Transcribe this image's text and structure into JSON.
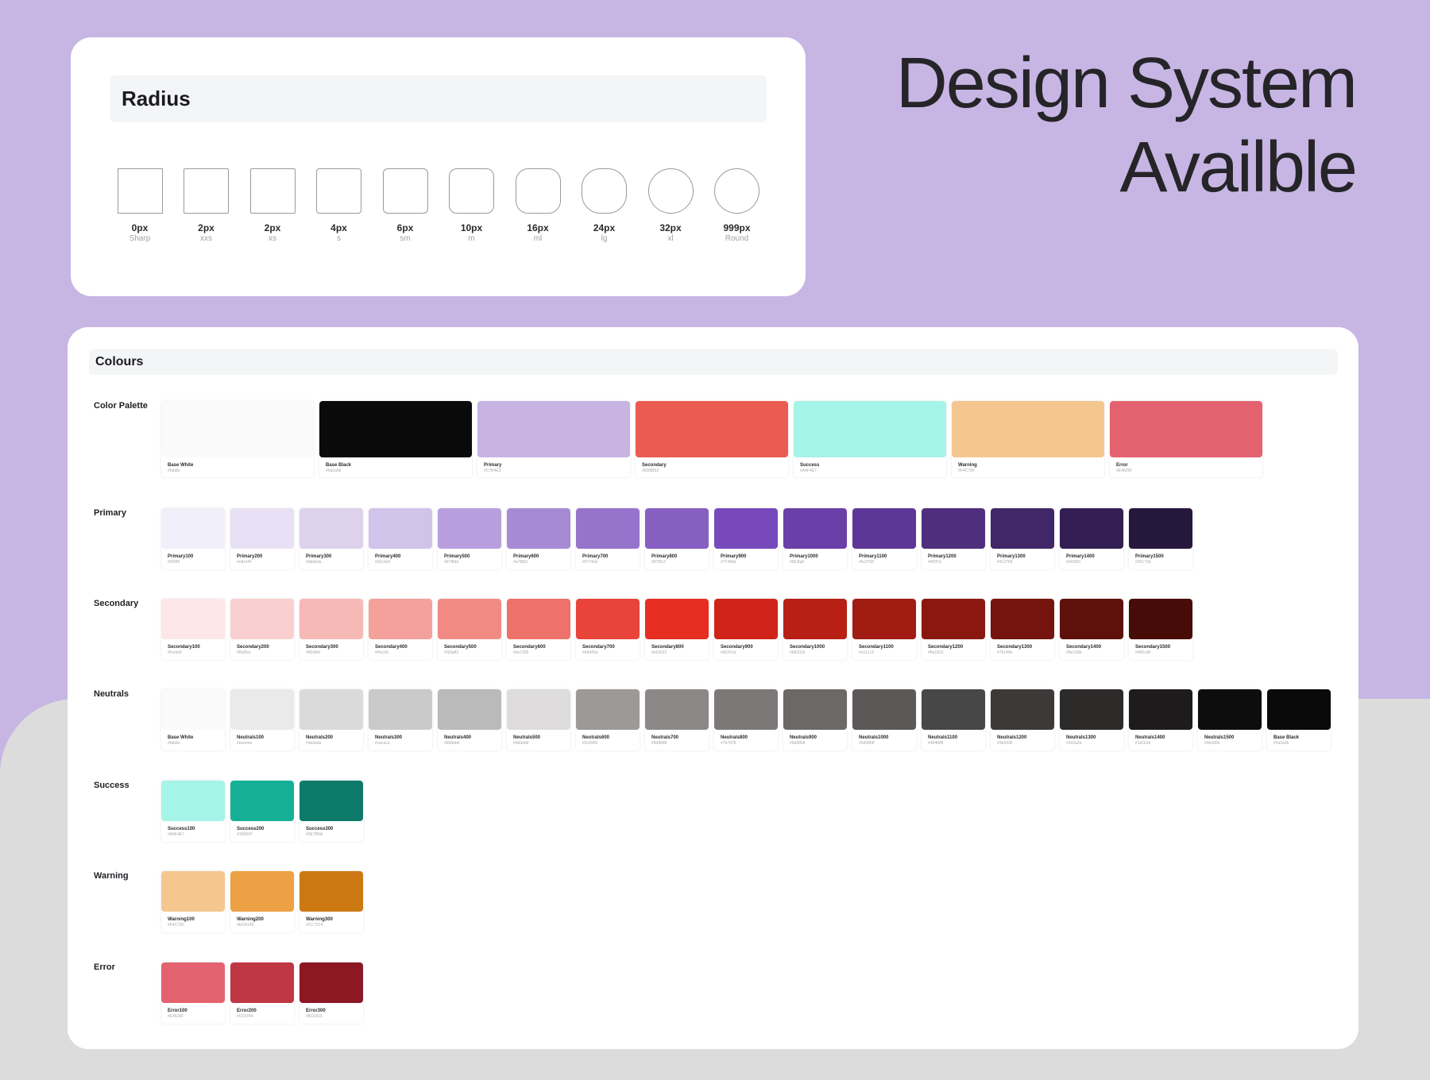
{
  "headline": {
    "line1": "Design System",
    "line2": "Availble"
  },
  "radius": {
    "title": "Radius",
    "items": [
      {
        "value": "0px",
        "name": "Sharp",
        "radius": 0
      },
      {
        "value": "2px",
        "name": "xxs",
        "radius": 2
      },
      {
        "value": "2px",
        "name": "xs",
        "radius": 2
      },
      {
        "value": "4px",
        "name": "s",
        "radius": 4
      },
      {
        "value": "6px",
        "name": "sm",
        "radius": 6
      },
      {
        "value": "10px",
        "name": "m",
        "radius": 10
      },
      {
        "value": "16px",
        "name": "ml",
        "radius": 16
      },
      {
        "value": "24px",
        "name": "lg",
        "radius": 24
      },
      {
        "value": "32px",
        "name": "xl",
        "radius": 32
      },
      {
        "value": "999px",
        "name": "Round",
        "radius": 999
      }
    ]
  },
  "colours": {
    "title": "Colours",
    "palette": {
      "label": "Color Palette",
      "swatches": [
        {
          "name": "Base White",
          "hex": "#fafafa",
          "color": "#fafafa"
        },
        {
          "name": "Base Black",
          "hex": "#0a0a0b",
          "color": "#0a0a0b"
        },
        {
          "name": "Primary",
          "hex": "#C7B4E3",
          "color": "#C7B4E3"
        },
        {
          "name": "Secondary",
          "hex": "#EB5B52",
          "color": "#EB5B52"
        },
        {
          "name": "Success",
          "hex": "#A4F4E7",
          "color": "#A4F4E7"
        },
        {
          "name": "Warning",
          "hex": "#F4C790",
          "color": "#F4C790"
        },
        {
          "name": "Error",
          "hex": "#E4626F",
          "color": "#E4626F"
        }
      ]
    },
    "rows": [
      {
        "id": "primary",
        "label": "Primary",
        "swatches": [
          {
            "name": "Primary100",
            "hex": "#f1f0f9",
            "color": "#f1effa"
          },
          {
            "name": "Primary200",
            "hex": "#e9e1f4",
            "color": "#e8e0f4"
          },
          {
            "name": "Primary300",
            "hex": "#ddd2eb",
            "color": "#ddd1ec"
          },
          {
            "name": "Primary400",
            "hex": "#d2c3e9",
            "color": "#d1c3e9"
          },
          {
            "name": "Primary500",
            "hex": "#b79fdd",
            "color": "#b79fdd"
          },
          {
            "name": "Primary600",
            "hex": "#a78fd3",
            "color": "#a68bd4"
          },
          {
            "name": "Primary700",
            "hex": "#9774cb",
            "color": "#9774cb"
          },
          {
            "name": "Primary800",
            "hex": "#875fc3",
            "color": "#875fc3"
          },
          {
            "name": "Primary900",
            "hex": "#7749bb",
            "color": "#7749bb"
          },
          {
            "name": "Primary1000",
            "hex": "#6b3fa8",
            "color": "#6b3fa8"
          },
          {
            "name": "Primary1100",
            "hex": "#5c3793",
            "color": "#5e3796"
          },
          {
            "name": "Primary1200",
            "hex": "#4f2f7d",
            "color": "#4f2f7d"
          },
          {
            "name": "Primary1300",
            "hex": "#412768",
            "color": "#412768"
          },
          {
            "name": "Primary1400",
            "hex": "#341f53",
            "color": "#331f53"
          },
          {
            "name": "Primary1500",
            "hex": "#26173d",
            "color": "#26173d"
          }
        ]
      },
      {
        "id": "secondary",
        "label": "Secondary",
        "swatches": [
          {
            "name": "Secondary100",
            "hex": "#fce6e6",
            "color": "#fce6e6"
          },
          {
            "name": "Secondary200",
            "hex": "#f9d0ce",
            "color": "#f9d0cf"
          },
          {
            "name": "Secondary300",
            "hex": "#f6b9b9",
            "color": "#f6b9b6"
          },
          {
            "name": "Secondary400",
            "hex": "#f4a19c",
            "color": "#f4a19c"
          },
          {
            "name": "Secondary500",
            "hex": "#f18a83",
            "color": "#f18a83"
          },
          {
            "name": "Secondary600",
            "hex": "#ee7265",
            "color": "#ee7269"
          },
          {
            "name": "Secondary700",
            "hex": "#e8443a",
            "color": "#e8443a"
          },
          {
            "name": "Secondary800",
            "hex": "#e62e22",
            "color": "#e62e22"
          },
          {
            "name": "Secondary900",
            "hex": "#d0241a",
            "color": "#d0241a"
          },
          {
            "name": "Secondary1000",
            "hex": "#b82016",
            "color": "#b82016"
          },
          {
            "name": "Secondary1100",
            "hex": "#a11c13",
            "color": "#a11c13"
          },
          {
            "name": "Secondary1200",
            "hex": "#8a1810",
            "color": "#8a1810"
          },
          {
            "name": "Secondary1300",
            "hex": "#75140e",
            "color": "#75140e"
          },
          {
            "name": "Secondary1400",
            "hex": "#5e100b",
            "color": "#5e100b"
          },
          {
            "name": "Secondary1500",
            "hex": "#480c08",
            "color": "#480c08"
          }
        ]
      },
      {
        "id": "neutrals",
        "label": "Neutrals",
        "swatches": [
          {
            "name": "Base White",
            "hex": "#fafafa",
            "color": "#fafafa"
          },
          {
            "name": "Neutrals100",
            "hex": "#eeeeee",
            "color": "#eaeaea"
          },
          {
            "name": "Neutrals200",
            "hex": "#dadada",
            "color": "#dadada"
          },
          {
            "name": "Neutrals300",
            "hex": "#cacaca",
            "color": "#cacaca"
          },
          {
            "name": "Neutrals400",
            "hex": "#bbbbbb",
            "color": "#bbbaba"
          },
          {
            "name": "Neutrals500",
            "hex": "#dddddd",
            "color": "#dedcdd"
          },
          {
            "name": "Neutrals600",
            "hex": "#9c9999",
            "color": "#9c9999"
          },
          {
            "name": "Neutrals700",
            "hex": "#8d8888",
            "color": "#8d8888"
          },
          {
            "name": "Neutrals800",
            "hex": "#7d7878",
            "color": "#7d7878"
          },
          {
            "name": "Neutrals900",
            "hex": "#6d6868",
            "color": "#6d6868"
          },
          {
            "name": "Neutrals1000",
            "hex": "#5d5858",
            "color": "#5d5858"
          },
          {
            "name": "Neutrals1100",
            "hex": "#484848",
            "color": "#484747"
          },
          {
            "name": "Neutrals1200",
            "hex": "#3d3939",
            "color": "#3d3939"
          },
          {
            "name": "Neutrals1300",
            "hex": "#2d2a2a",
            "color": "#2d2a2a"
          },
          {
            "name": "Neutrals1400",
            "hex": "#1d1b1b",
            "color": "#1d1b1b"
          },
          {
            "name": "Neutrals1500",
            "hex": "#0e0d0e",
            "color": "#0e0d0e"
          },
          {
            "name": "Base Black",
            "hex": "#0a0a0b",
            "color": "#0a0a0b"
          }
        ]
      },
      {
        "id": "success",
        "label": "Success",
        "swatches": [
          {
            "name": "Success100",
            "hex": "#A4F4E7",
            "color": "#A4F4E7"
          },
          {
            "name": "Success200",
            "hex": "#16B097",
            "color": "#16B097"
          },
          {
            "name": "Success300",
            "hex": "#0E7B6A",
            "color": "#0E7B6A"
          }
        ]
      },
      {
        "id": "warning",
        "label": "Warning",
        "swatches": [
          {
            "name": "Warning100",
            "hex": "#F4C790",
            "color": "#F4C790"
          },
          {
            "name": "Warning200",
            "hex": "#EDA145",
            "color": "#EDA145"
          },
          {
            "name": "Warning300",
            "hex": "#CC7914",
            "color": "#CC7914"
          }
        ]
      },
      {
        "id": "error",
        "label": "Error",
        "swatches": [
          {
            "name": "Error100",
            "hex": "#E4626F",
            "color": "#E4626F"
          },
          {
            "name": "Error200",
            "hex": "#C03744",
            "color": "#C03744"
          },
          {
            "name": "Error300",
            "hex": "#8C1823",
            "color": "#8C1823"
          }
        ]
      }
    ]
  }
}
